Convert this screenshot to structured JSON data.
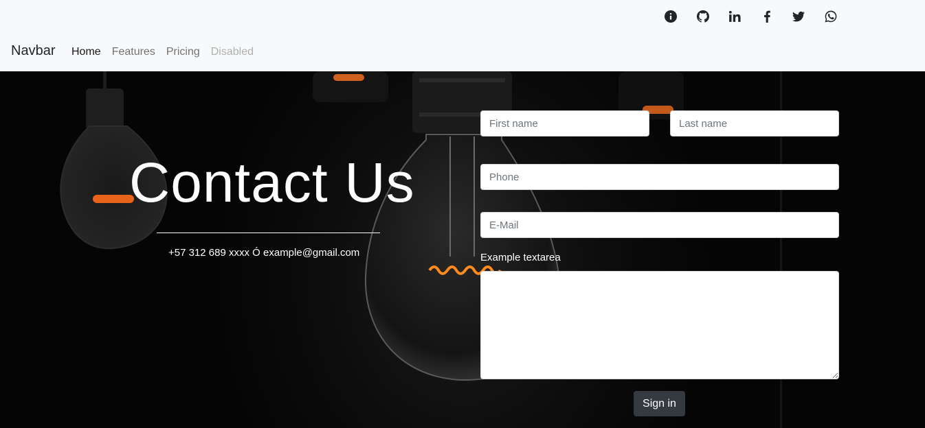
{
  "navbar": {
    "brand": "Navbar",
    "links": [
      {
        "label": "Home",
        "state": "active"
      },
      {
        "label": "Features",
        "state": "normal"
      },
      {
        "label": "Pricing",
        "state": "normal"
      },
      {
        "label": "Disabled",
        "state": "disabled"
      }
    ],
    "social_icons": [
      "info-icon",
      "github-icon",
      "linkedin-icon",
      "facebook-icon",
      "twitter-icon",
      "whatsapp-icon"
    ]
  },
  "hero": {
    "title": "Contact Us",
    "contact_line": "+57 312 689 xxxx Ó example@gmail.com"
  },
  "form": {
    "first_name_placeholder": "First name",
    "last_name_placeholder": "Last name",
    "phone_placeholder": "Phone",
    "email_placeholder": "E-Mail",
    "textarea_label": "Example textarea",
    "submit_label": "Sign in"
  },
  "colors": {
    "navbar_bg": "#f8f9fa",
    "hero_bg": "#0a0a0a",
    "filament_glow": "#ff7a1a",
    "button_bg": "#343a40"
  }
}
